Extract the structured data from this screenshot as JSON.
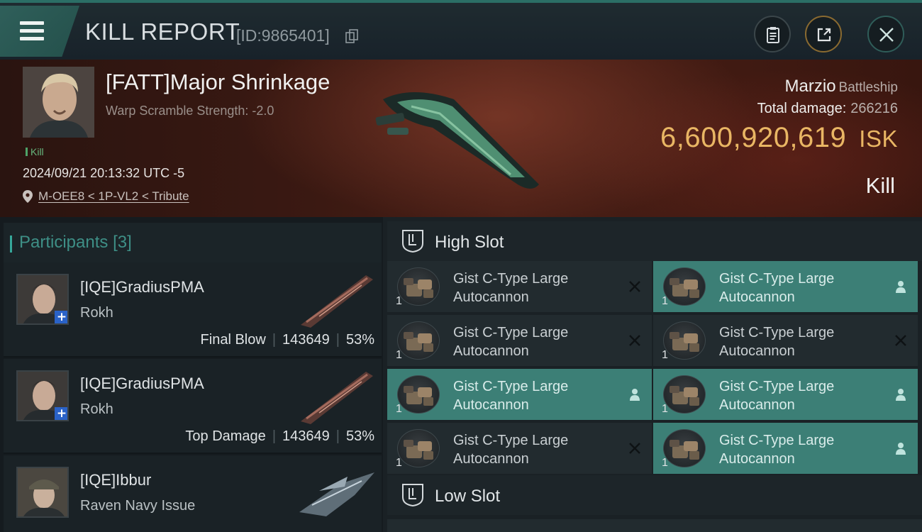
{
  "header": {
    "title": "KILL REPORT",
    "id_text": "[ID:9865401]",
    "icons": [
      "menu-icon",
      "copy-icon",
      "clipboard-icon",
      "share-icon",
      "close-icon"
    ]
  },
  "victim": {
    "name": "[FATT]Major Shrinkage",
    "subtitle": "Warp Scramble Strength: -2.0",
    "tag": "Kill",
    "datetime": "2024/09/21 20:13:32 UTC -5",
    "location": "M-OEE8 < 1P-VL2 < Tribute",
    "ship": "Marzio",
    "ship_class": "Battleship",
    "total_damage_label": "Total damage:",
    "total_damage": "266216",
    "isk_value": "6,600,920,619",
    "isk_unit": "ISK",
    "result": "Kill"
  },
  "participants": {
    "title": "Participants",
    "count": "[3]",
    "rows": [
      {
        "name": "[IQE]GradiusPMA",
        "ship": "Rokh",
        "label": "Final Blow",
        "damage": "143649",
        "percent": "53%"
      },
      {
        "name": "[IQE]GradiusPMA",
        "ship": "Rokh",
        "label": "Top Damage",
        "damage": "143649",
        "percent": "53%"
      },
      {
        "name": "[IQE]Ibbur",
        "ship": "Raven Navy Issue"
      }
    ]
  },
  "slots": {
    "high_label": "High Slot",
    "low_label": "Low Slot",
    "module_name_line1": "Gist C-Type Large",
    "module_name_line2": "Autocannon",
    "qty": "1",
    "high_modules": [
      {
        "status": "destroyed"
      },
      {
        "status": "dropped"
      },
      {
        "status": "destroyed"
      },
      {
        "status": "destroyed"
      },
      {
        "status": "dropped"
      },
      {
        "status": "dropped"
      },
      {
        "status": "destroyed"
      },
      {
        "status": "dropped"
      }
    ]
  },
  "colors": {
    "accent": "#3c7f76",
    "isk": "#e9b664",
    "kill_green": "#66b57c"
  }
}
